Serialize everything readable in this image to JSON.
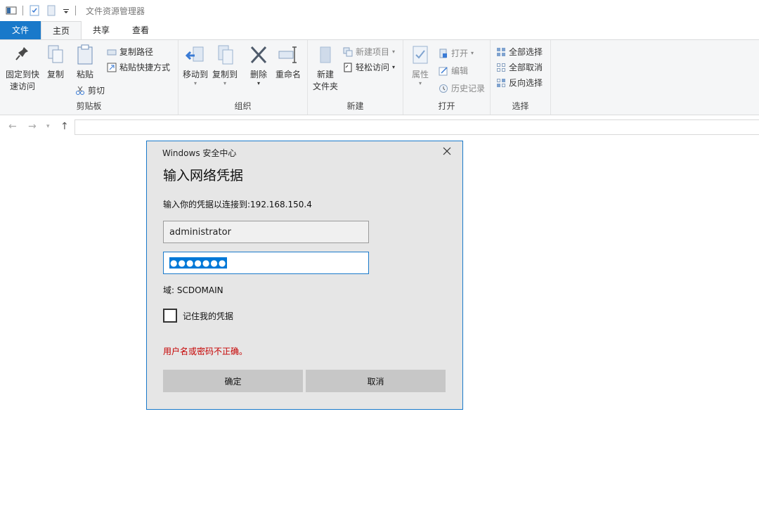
{
  "titlebar": {
    "title": "文件资源管理器"
  },
  "tabs": [
    {
      "label": "文件"
    },
    {
      "label": "主页"
    },
    {
      "label": "共享"
    },
    {
      "label": "查看"
    }
  ],
  "ribbon": {
    "clipboard": {
      "group": "剪贴板",
      "pin_line1": "固定到快",
      "pin_line2": "速访问",
      "copy": "复制",
      "paste": "粘贴",
      "copy_path": "复制路径",
      "paste_shortcut": "粘贴快捷方式",
      "cut": "剪切"
    },
    "organize": {
      "group": "组织",
      "move_to": "移动到",
      "copy_to": "复制到",
      "delete": "删除",
      "rename": "重命名"
    },
    "new": {
      "group": "新建",
      "new_folder_line1": "新建",
      "new_folder_line2": "文件夹",
      "new_item": "新建项目",
      "easy_access": "轻松访问"
    },
    "open": {
      "group": "打开",
      "properties": "属性",
      "open": "打开",
      "edit": "编辑",
      "history": "历史记录"
    },
    "select": {
      "group": "选择",
      "select_all": "全部选择",
      "select_none": "全部取消",
      "invert": "反向选择"
    }
  },
  "dialog": {
    "caption": "Windows 安全中心",
    "heading": "输入网络凭据",
    "description": "输入你的凭据以连接到:192.168.150.4",
    "username": "administrator",
    "password_masked": "●●●●●●●",
    "domain": "域: SCDOMAIN",
    "remember": "记住我的凭据",
    "remember_checked": false,
    "error": "用户名或密码不正确。",
    "ok": "确定",
    "cancel": "取消"
  },
  "colors": {
    "accent": "#1979ca",
    "error": "#c50000",
    "selection": "#0078d7"
  }
}
